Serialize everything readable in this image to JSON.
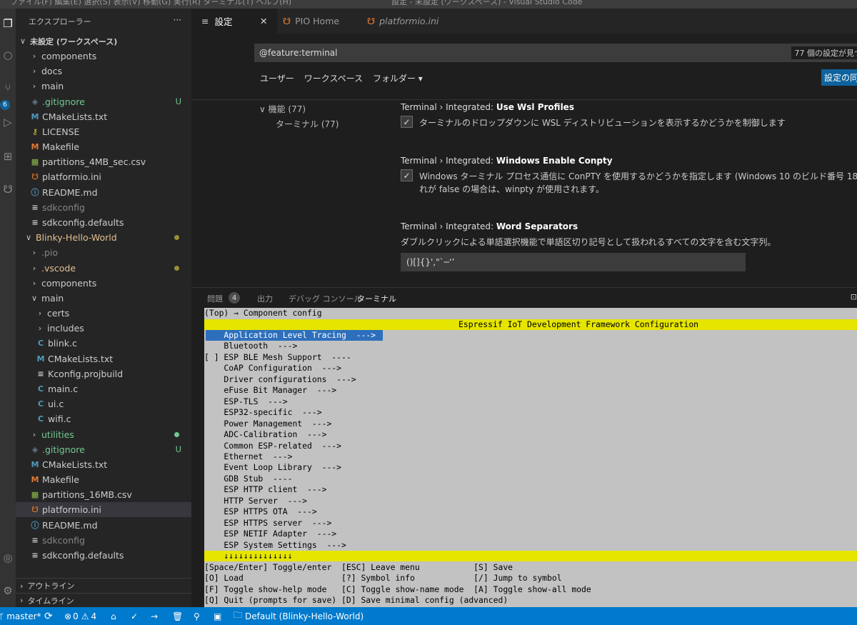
{
  "titlebar": {
    "left": "ファイル(F)   編集(E)   選択(S)   表示(V)   移動(G)   実行(R)   ターミナル(T)   ヘルプ(H)",
    "right": "設定 - 未設定 (ワークスペース) - Visual Studio Code"
  },
  "activity_icons": [
    "files-icon",
    "search-icon",
    "source-control-icon",
    "run-debug-icon",
    "extensions-icon",
    "platformio-icon",
    "account-icon",
    "manage-gear-icon"
  ],
  "activity_badge": "6",
  "sidebar": {
    "title": "エクスプローラー",
    "more": "···",
    "workspace": "未設定 (ワークスペース)",
    "items": [
      {
        "label": "components",
        "type": "folder",
        "indent": 1,
        "open": false
      },
      {
        "label": "docs",
        "type": "folder",
        "indent": 1,
        "open": false
      },
      {
        "label": "main",
        "type": "folder",
        "indent": 1,
        "open": false
      },
      {
        "label": ".gitignore",
        "type": "git",
        "indent": 1,
        "status": "U",
        "color": "green"
      },
      {
        "label": "CMakeLists.txt",
        "type": "cmake",
        "indent": 1
      },
      {
        "label": "LICENSE",
        "type": "license",
        "indent": 1
      },
      {
        "label": "Makefile",
        "type": "make",
        "indent": 1
      },
      {
        "label": "partitions_4MB_sec.csv",
        "type": "csv",
        "indent": 1
      },
      {
        "label": "platformio.ini",
        "type": "pio",
        "indent": 1
      },
      {
        "label": "README.md",
        "type": "info",
        "indent": 1
      },
      {
        "label": "sdkconfig",
        "type": "text",
        "indent": 1,
        "color": "gray"
      },
      {
        "label": "sdkconfig.defaults",
        "type": "text",
        "indent": 1
      },
      {
        "label": "Blinky-Hello-World",
        "type": "folder",
        "indent": 0,
        "open": true,
        "color": "yel",
        "dot": "olive"
      },
      {
        "label": ".pio",
        "type": "folder",
        "indent": 1,
        "open": false,
        "color": "gray"
      },
      {
        "label": ".vscode",
        "type": "folder",
        "indent": 1,
        "open": false,
        "color": "yel",
        "dot": "olive"
      },
      {
        "label": "components",
        "type": "folder",
        "indent": 1,
        "open": false
      },
      {
        "label": "main",
        "type": "folder",
        "indent": 1,
        "open": true
      },
      {
        "label": "certs",
        "type": "folder",
        "indent": 2,
        "open": false
      },
      {
        "label": "includes",
        "type": "folder",
        "indent": 2,
        "open": false
      },
      {
        "label": "blink.c",
        "type": "c",
        "indent": 2
      },
      {
        "label": "CMakeLists.txt",
        "type": "cmake",
        "indent": 2
      },
      {
        "label": "Kconfig.projbuild",
        "type": "text",
        "indent": 2
      },
      {
        "label": "main.c",
        "type": "c",
        "indent": 2
      },
      {
        "label": "ui.c",
        "type": "c",
        "indent": 2
      },
      {
        "label": "wifi.c",
        "type": "c",
        "indent": 2
      },
      {
        "label": "utilities",
        "type": "folder",
        "indent": 1,
        "open": false,
        "color": "green",
        "dot": "green"
      },
      {
        "label": ".gitignore",
        "type": "git",
        "indent": 1,
        "status": "U",
        "color": "green"
      },
      {
        "label": "CMakeLists.txt",
        "type": "cmake",
        "indent": 1
      },
      {
        "label": "Makefile",
        "type": "make",
        "indent": 1
      },
      {
        "label": "partitions_16MB.csv",
        "type": "csv",
        "indent": 1
      },
      {
        "label": "platformio.ini",
        "type": "pio",
        "indent": 1,
        "selected": true
      },
      {
        "label": "README.md",
        "type": "info",
        "indent": 1
      },
      {
        "label": "sdkconfig",
        "type": "text",
        "indent": 1,
        "color": "gray"
      },
      {
        "label": "sdkconfig.defaults",
        "type": "text",
        "indent": 1
      }
    ],
    "outline": "アウトライン",
    "timeline": "タイムライン"
  },
  "tabs": [
    {
      "label": "設定",
      "icon": "≡",
      "active": true
    },
    {
      "label": "PIO Home",
      "icon": "pio",
      "close": "✕"
    },
    {
      "label": "platformio.ini",
      "icon": "pio",
      "italic": true
    }
  ],
  "settings": {
    "search_value": "@feature:terminal",
    "result_count": "77 個の設定が見つ",
    "scopes": [
      "ユーザー",
      "ワークスペース",
      "フォルダー ▾"
    ],
    "sync_button": "設定の同",
    "toc": [
      {
        "label": "∨ 機能 (77)"
      },
      {
        "label": "ターミナル (77)"
      }
    ],
    "items": [
      {
        "prefix": "Terminal › Integrated: ",
        "name": "Use Wsl Profiles",
        "desc": [
          "ターミナルのドロップダウンに WSL ディストリビューションを表示するかどうかを制御します"
        ],
        "checked": true
      },
      {
        "prefix": "Terminal › Integrated: ",
        "name": "Windows Enable Conpty",
        "desc": [
          "Windows ターミナル プロセス通信に ConPTY を使用するかどうかを指定します (Windows 10 のビルド番号 18309 以上が必",
          "れが false の場合は、winpty が使用されます。"
        ],
        "checked": true
      },
      {
        "prefix": "Terminal › Integrated: ",
        "name": "Word Separators",
        "desc": [
          "ダブルクリックによる単語選択機能で単語区切り記号として扱われるすべての文字を含む文字列。"
        ],
        "value": "()[]{}',\"`─‘’"
      }
    ]
  },
  "panel": {
    "tabs": [
      "問題",
      "出力",
      "デバッグ コンソール",
      "ターミナル"
    ],
    "problem_count": "4",
    "max_icon": "⊡"
  },
  "terminal": {
    "breadcrumb": "(Top) → Component config",
    "header": "Espressif IoT Development Framework Configuration",
    "menu": [
      "    Application Level Tracing  --->",
      "    Bluetooth  --->",
      "[ ] ESP BLE Mesh Support  ----",
      "    CoAP Configuration  --->",
      "    Driver configurations  --->",
      "    eFuse Bit Manager  --->",
      "    ESP-TLS  --->",
      "    ESP32-specific  --->",
      "    Power Management  --->",
      "    ADC-Calibration  --->",
      "    Common ESP-related  --->",
      "    Ethernet  --->",
      "    Event Loop Library  --->",
      "    GDB Stub  ----",
      "    ESP HTTP client  --->",
      "    HTTP Server  --->",
      "    ESP HTTPS OTA  --->",
      "    ESP HTTPS server  --->",
      "    ESP NETIF Adapter  --->",
      "    ESP System Settings  --->"
    ],
    "more_marker": "    ↓↓↓↓↓↓↓↓↓↓↓↓↓↓",
    "help": [
      "[Space/Enter] Toggle/enter  [ESC] Leave menu           [S] Save",
      "[O] Load                    [?] Symbol info            [/] Jump to symbol",
      "[F] Toggle show-help mode   [C] Toggle show-name mode  [A] Toggle show-all mode",
      "[Q] Quit (prompts for save) [D] Save minimal config (advanced)"
    ]
  },
  "statusbar": {
    "branch": "master*",
    "sync": "⟳",
    "errors": "0",
    "warnings": "4",
    "icons": [
      "⌂",
      "✓",
      "→",
      "🗑",
      "⚲",
      "▣"
    ],
    "env": "Default (Blinky-Hello-World)"
  },
  "colors": {
    "accent": "#007acc",
    "sidebar": "#252526",
    "editor": "#1e1e1e",
    "terminal_bg": "#c2c2c2",
    "terminal_band": "#e5e500",
    "terminal_highlight": "#2d6fbd"
  }
}
